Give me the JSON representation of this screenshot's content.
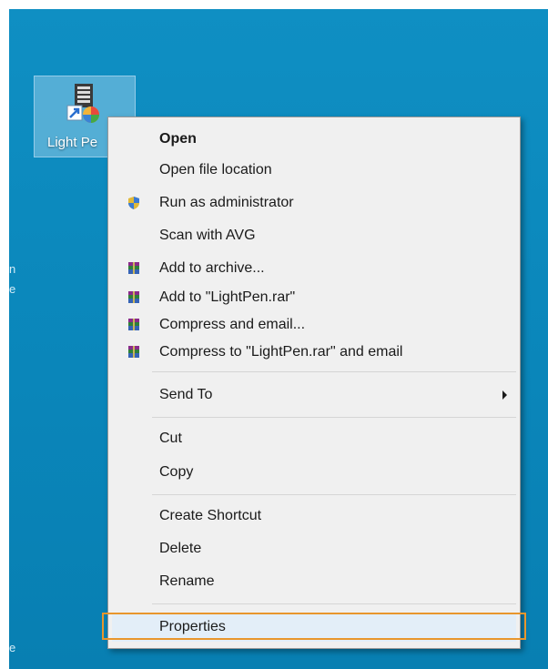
{
  "desktop": {
    "icon_label": "Light Pe",
    "edge_marks": [
      "n",
      "e",
      "e"
    ]
  },
  "context_menu": {
    "items": [
      {
        "label": "Open",
        "bold": true,
        "icon": ""
      },
      {
        "label": "Open file location",
        "icon": ""
      },
      {
        "label": "Run as administrator",
        "icon": "uac-shield-icon"
      },
      {
        "label": "Scan with AVG",
        "icon": ""
      },
      {
        "label": "Add to archive...",
        "icon": "winrar-icon"
      },
      {
        "label": "Add to \"LightPen.rar\"",
        "icon": "winrar-icon"
      },
      {
        "label": "Compress and email...",
        "icon": "winrar-icon"
      },
      {
        "label": "Compress to \"LightPen.rar\" and email",
        "icon": "winrar-icon"
      },
      {
        "label": "Send To",
        "icon": "",
        "submenu": true
      },
      {
        "label": "Cut",
        "icon": ""
      },
      {
        "label": "Copy",
        "icon": ""
      },
      {
        "label": "Create Shortcut",
        "icon": ""
      },
      {
        "label": "Delete",
        "icon": ""
      },
      {
        "label": "Rename",
        "icon": ""
      },
      {
        "label": "Properties",
        "icon": "",
        "highlighted": true
      }
    ]
  },
  "colors": {
    "desktop_bg": "#0a86ba",
    "menu_bg": "#f0f0f0",
    "highlight_box": "#e8962d"
  }
}
